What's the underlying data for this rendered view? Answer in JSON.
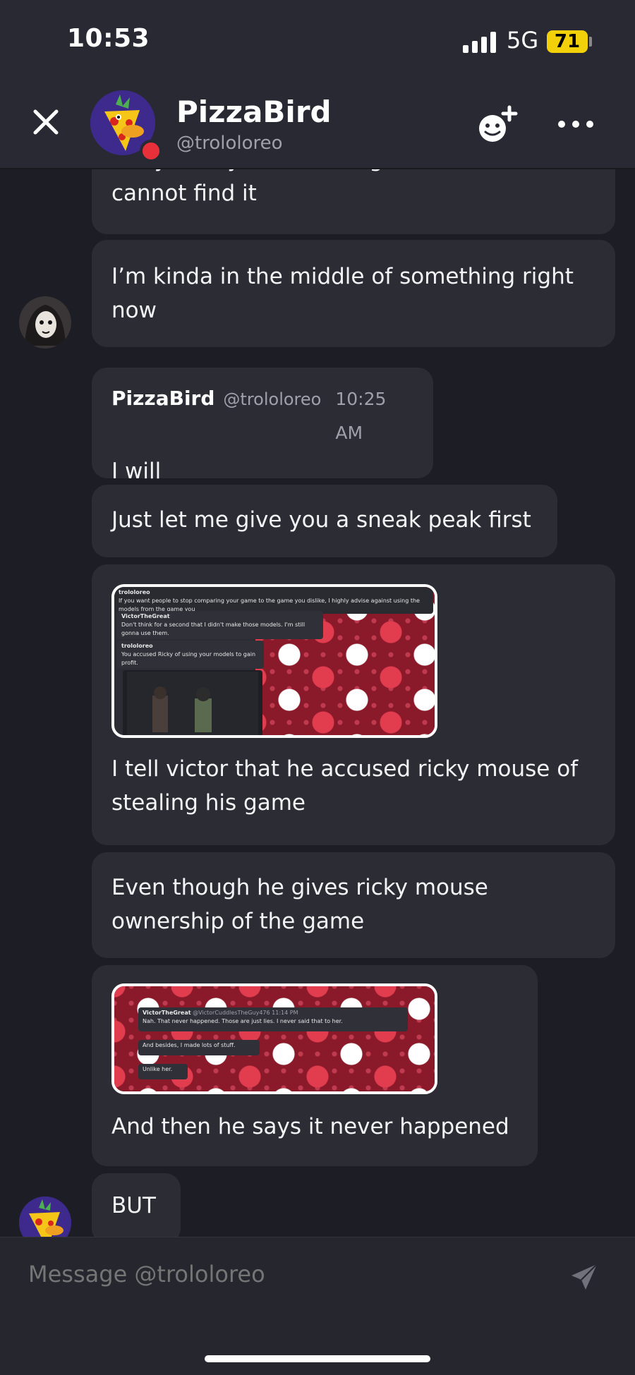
{
  "status": {
    "time": "10:53",
    "network": "5G",
    "battery": "71"
  },
  "header": {
    "name": "PizzaBird",
    "handle": "@trololoreo"
  },
  "messages": {
    "m0": "Okay, can you send it again because I cannot find it",
    "m1": "I’m kinda in the middle of something right now",
    "m2_name": "PizzaBird",
    "m2_handle": "@trololoreo",
    "m2_time": "10:25 AM",
    "m2": "I will",
    "m3": "Just let me give you a sneak peak first",
    "img1": {
      "top_user": "trololoreo",
      "top_text": "If you want people to stop comparing your game to the game you dislike, I highly advise against using the models from the game you",
      "user2": "VictorTheGreat",
      "line2": "Don't think for a second that I didn't make those models. I'm still gonna use them.",
      "user3": "trololoreo",
      "line3": "You accused Ricky of using your models to gain profit."
    },
    "m4": "I tell victor that he accused ricky mouse of stealing his game",
    "m5": "Even though he gives ricky mouse ownership of the game",
    "img2": {
      "user": "VictorTheGreat",
      "tag": "@VictorCuddlesTheGuy476",
      "time": "11:14 PM",
      "line1": "Nah. That never happened. Those are just lies. I never said that to her.",
      "line2": "And besides, I made lots of stuff.",
      "line3": "Unlike her."
    },
    "m6": "And then he says it never happened",
    "m7": "BUT"
  },
  "composer": {
    "placeholder": "Message @trololoreo"
  },
  "colors": {
    "background": "#1d1e25",
    "bubble": "#2b2c34",
    "header": "#282932",
    "battery": "#f2d10a",
    "presence": "#e8303a"
  }
}
